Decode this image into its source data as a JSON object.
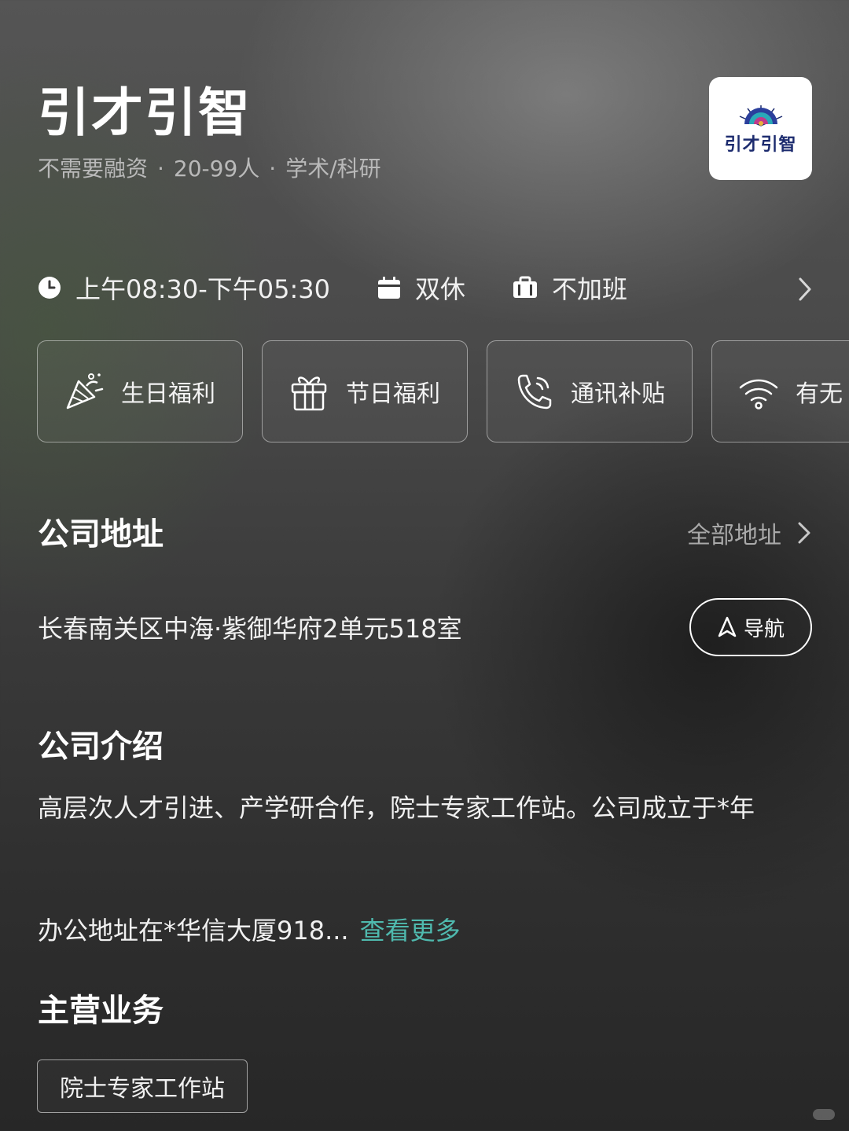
{
  "company": {
    "name": "引才引智",
    "funding": "不需要融资",
    "size": "20-99人",
    "industry": "学术/科研",
    "separator": "·",
    "logo_text": "引才引智"
  },
  "work_info": {
    "hours": "上午08:30-下午05:30",
    "rest": "双休",
    "overtime": "不加班",
    "icons": [
      "clock-icon",
      "calendar-icon",
      "briefcase-icon",
      "chevron-right-icon"
    ]
  },
  "benefits": [
    {
      "label": "生日福利",
      "icon": "party-popper-icon"
    },
    {
      "label": "节日福利",
      "icon": "gift-icon"
    },
    {
      "label": "通讯补贴",
      "icon": "phone-icon"
    },
    {
      "label": "有无",
      "icon": "wifi-icon"
    }
  ],
  "address_section": {
    "title": "公司地址",
    "all_link": "全部地址",
    "address": "长春南关区中海·紫御华府2单元518室",
    "nav_label": "导航"
  },
  "intro_section": {
    "title": "公司介绍",
    "text_line1": "高层次人才引进、产学研合作，院士专家工作站。公司成立于*年",
    "text_line2": "办公地址在*华信大厦918...",
    "more_label": "查看更多"
  },
  "business_section": {
    "title": "主营业务",
    "tags": [
      "院士专家工作站"
    ]
  },
  "colors": {
    "accent_link": "#4fb9ae",
    "text_primary": "#ffffff",
    "text_secondary": "#b9b9b9"
  }
}
